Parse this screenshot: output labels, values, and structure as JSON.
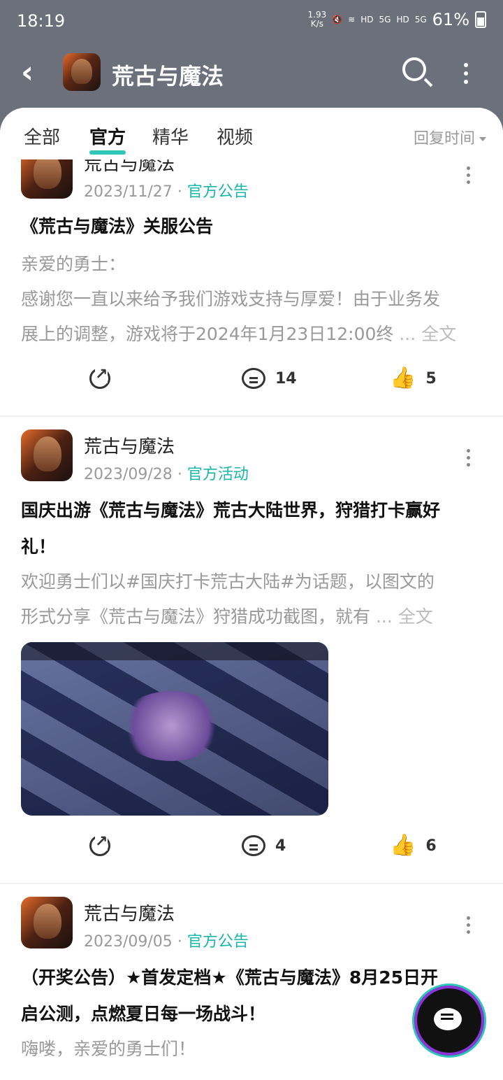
{
  "status_bar": {
    "time": "18:19",
    "net_speed": "1.93\nK/s",
    "hd1": "HD",
    "sig1": "5G",
    "hd2": "HD",
    "sig2": "5G",
    "battery": "61%"
  },
  "header": {
    "title": "荒古与魔法"
  },
  "tabs": {
    "items": [
      "全部",
      "官方",
      "精华",
      "视频"
    ],
    "active": "官方",
    "sort_label": "回复时间"
  },
  "posts": [
    {
      "author": "荒古与魔法",
      "date": "2023/11/27",
      "sep": "·",
      "tag": "官方公告",
      "title": "《荒古与魔法》关服公告",
      "body_line1": "亲爱的勇士：",
      "body_line2": "感谢您一直以来给予我们游戏支持与厚爱！由于业务发",
      "body_line3": "展上的调整，游戏将于2024年1月23日12:00终",
      "full": "... 全文",
      "comments": "14",
      "likes": "5"
    },
    {
      "author": "荒古与魔法",
      "date": "2023/09/28",
      "sep": "·",
      "tag": "官方活动",
      "title_line1": "国庆出游《荒古与魔法》荒古大陆世界，狩猎打卡赢好",
      "title_line2": "礼！",
      "body_line1": "欢迎勇士们以#国庆打卡荒古大陆#为话题，以图文的",
      "body_line2": "形式分享《荒古与魔法》狩猎成功截图，就有",
      "full": "... 全文",
      "comments": "4",
      "likes": "6"
    },
    {
      "author": "荒古与魔法",
      "date": "2023/09/05",
      "sep": "·",
      "tag": "官方公告",
      "title_line1": "（开奖公告）★首发定档★《荒古与魔法》8月25日开",
      "title_line2": "启公测，点燃夏日每一场战斗！",
      "body_line1": "嗨喽，亲爱的勇士们！"
    }
  ],
  "icons": {
    "accent": "#2fc5b8",
    "tag_color": "#19b7a9"
  }
}
